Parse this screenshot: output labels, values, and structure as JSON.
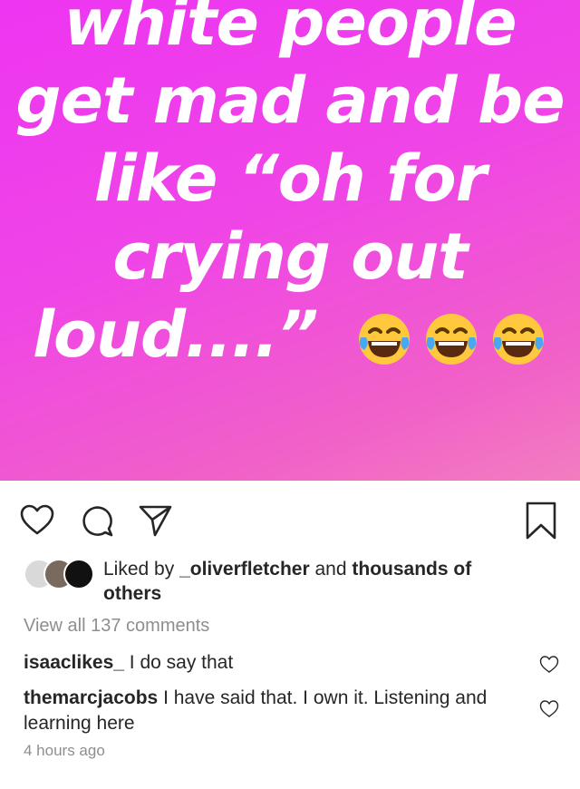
{
  "post": {
    "meme_lines": [
      "white people",
      "get mad and be",
      "like “oh for",
      "crying out",
      "loud....”"
    ],
    "emoji": [
      "face-with-tears-of-joy",
      "face-with-tears-of-joy",
      "face-with-tears-of-joy"
    ],
    "background_colors": [
      "#ee35f2",
      "#f27dc0"
    ]
  },
  "actions": {
    "icons": [
      "heart-icon",
      "comment-icon",
      "share-icon",
      "bookmark-icon"
    ]
  },
  "likes": {
    "prefix": "Liked by",
    "user": "_oliverfletcher",
    "middle": "and",
    "suffix": "thousands of others"
  },
  "comments": {
    "view_all": "View all 137 comments",
    "items": [
      {
        "user": "isaaclikes_",
        "text": "I do say that"
      },
      {
        "user": "themarcjacobs",
        "text": "I have said that. I own it. Listening and learning here"
      }
    ]
  },
  "timestamp": "4 hours ago"
}
